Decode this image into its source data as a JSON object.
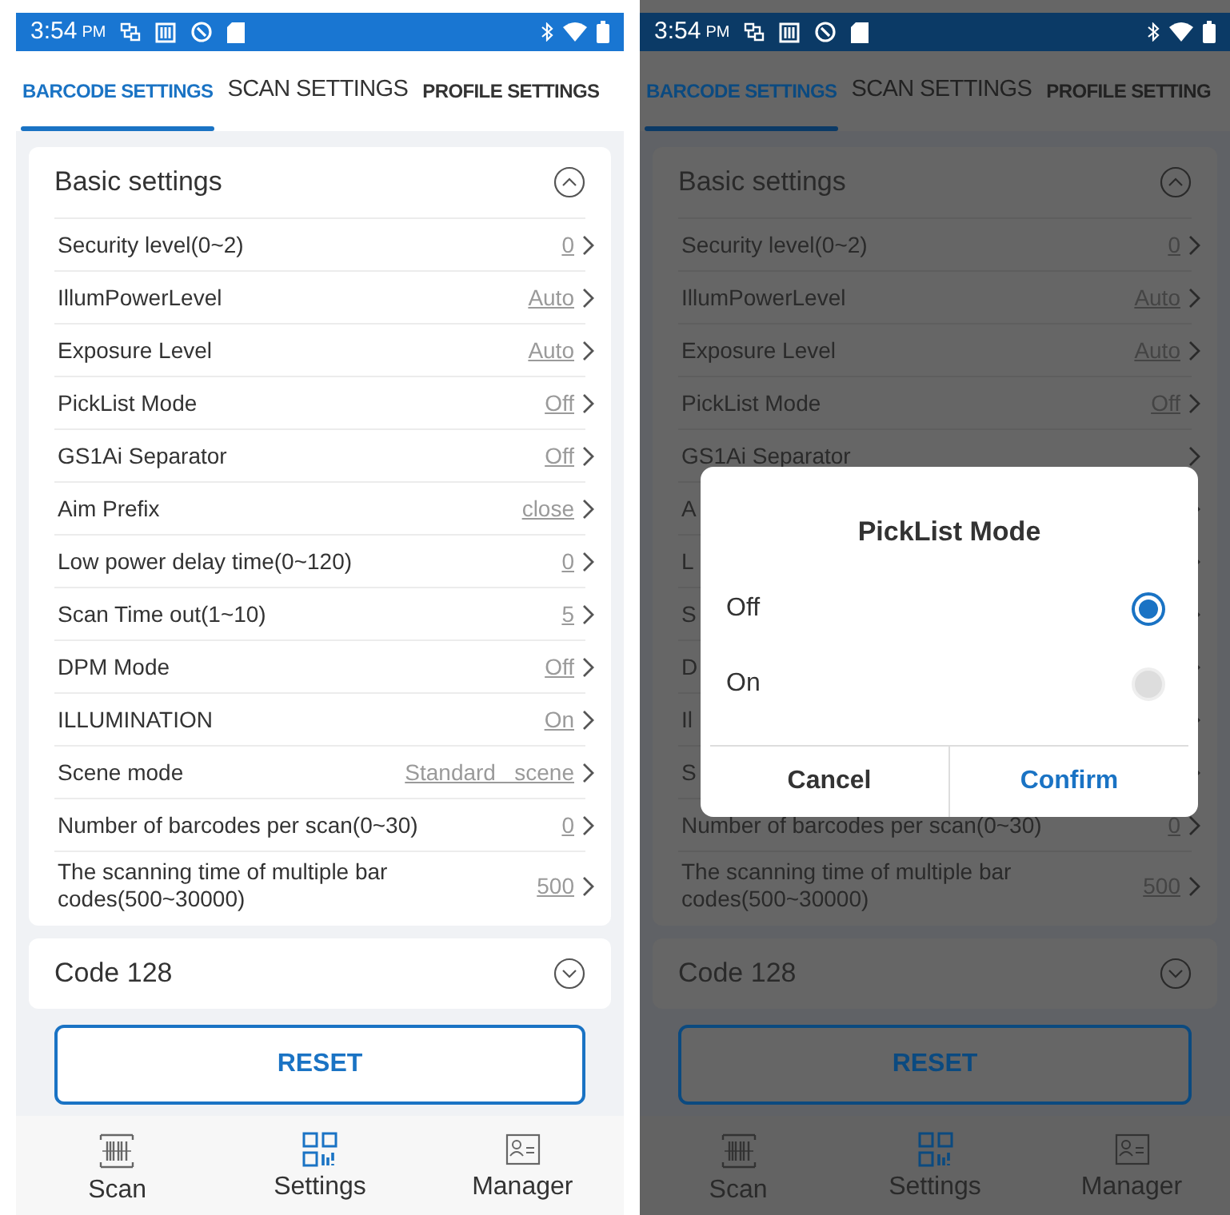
{
  "screens": [
    {
      "dimmed": false,
      "status_bar": {
        "time": "3:54",
        "ampm": "PM"
      },
      "tabs": [
        {
          "label": "BARCODE SETTINGS",
          "selected": true
        },
        {
          "label": "SCAN SETTINGS",
          "selected": false
        },
        {
          "label": "PROFILE SETTINGS",
          "selected": false
        }
      ],
      "sections": [
        {
          "title": "Basic settings",
          "expanded": true,
          "rows": [
            {
              "label": "Security level(0~2)",
              "value": "0"
            },
            {
              "label": "IllumPowerLevel",
              "value": "Auto"
            },
            {
              "label": "Exposure Level",
              "value": "Auto"
            },
            {
              "label": "PickList Mode",
              "value": "Off"
            },
            {
              "label": "GS1Ai Separator",
              "value": "Off"
            },
            {
              "label": "Aim Prefix",
              "value": "close"
            },
            {
              "label": "Low power delay time(0~120)",
              "value": "0"
            },
            {
              "label": "Scan Time out(1~10)",
              "value": "5"
            },
            {
              "label": "DPM Mode",
              "value": "Off"
            },
            {
              "label": "ILLUMINATION",
              "value": "On"
            },
            {
              "label": "Scene mode",
              "value": "Standard   scene"
            },
            {
              "label": "Number of barcodes per scan(0~30)",
              "value": "0"
            },
            {
              "label": "The scanning time of multiple bar codes(500~30000)",
              "value": "500"
            }
          ]
        },
        {
          "title": "Code 128",
          "expanded": false
        }
      ],
      "reset_button": "RESET",
      "bottom_nav": [
        {
          "label": "Scan",
          "selected": false
        },
        {
          "label": "Settings",
          "selected": true
        },
        {
          "label": "Manager",
          "selected": false
        }
      ]
    },
    {
      "dimmed": true,
      "status_bar": {
        "time": "3:54",
        "ampm": "PM"
      },
      "tabs": [
        {
          "label": "BARCODE SETTINGS",
          "selected": true
        },
        {
          "label": "SCAN SETTINGS",
          "selected": false
        },
        {
          "label": "PROFILE SETTING",
          "selected": false
        }
      ],
      "sections": [
        {
          "title": "Basic settings",
          "expanded": true,
          "rows": [
            {
              "label": "Security level(0~2)",
              "value": "0"
            },
            {
              "label": "IllumPowerLevel",
              "value": "Auto"
            },
            {
              "label": "Exposure Level",
              "value": "Auto"
            },
            {
              "label": "PickList Mode",
              "value": "Off"
            },
            {
              "label": "GS1Ai Separator"
            },
            {
              "label": "A"
            },
            {
              "label": "L"
            },
            {
              "label": "S"
            },
            {
              "label": "D"
            },
            {
              "label": "Il"
            },
            {
              "label": "S"
            },
            {
              "label": "Number of barcodes per scan(0~30)",
              "value": "0"
            },
            {
              "label": "The scanning time of multiple bar codes(500~30000)",
              "value": "500"
            }
          ]
        },
        {
          "title": "Code 128",
          "expanded": false
        }
      ],
      "reset_button": "RESET",
      "bottom_nav": [
        {
          "label": "Scan",
          "selected": false
        },
        {
          "label": "Settings",
          "selected": true
        },
        {
          "label": "Manager",
          "selected": false
        }
      ],
      "dialog": {
        "title": "PickList Mode",
        "options": [
          {
            "label": "Off",
            "selected": true
          },
          {
            "label": "On",
            "selected": false
          }
        ],
        "buttons": [
          {
            "label": "Cancel",
            "kind": "cancel"
          },
          {
            "label": "Confirm",
            "kind": "confirm"
          }
        ]
      }
    }
  ]
}
